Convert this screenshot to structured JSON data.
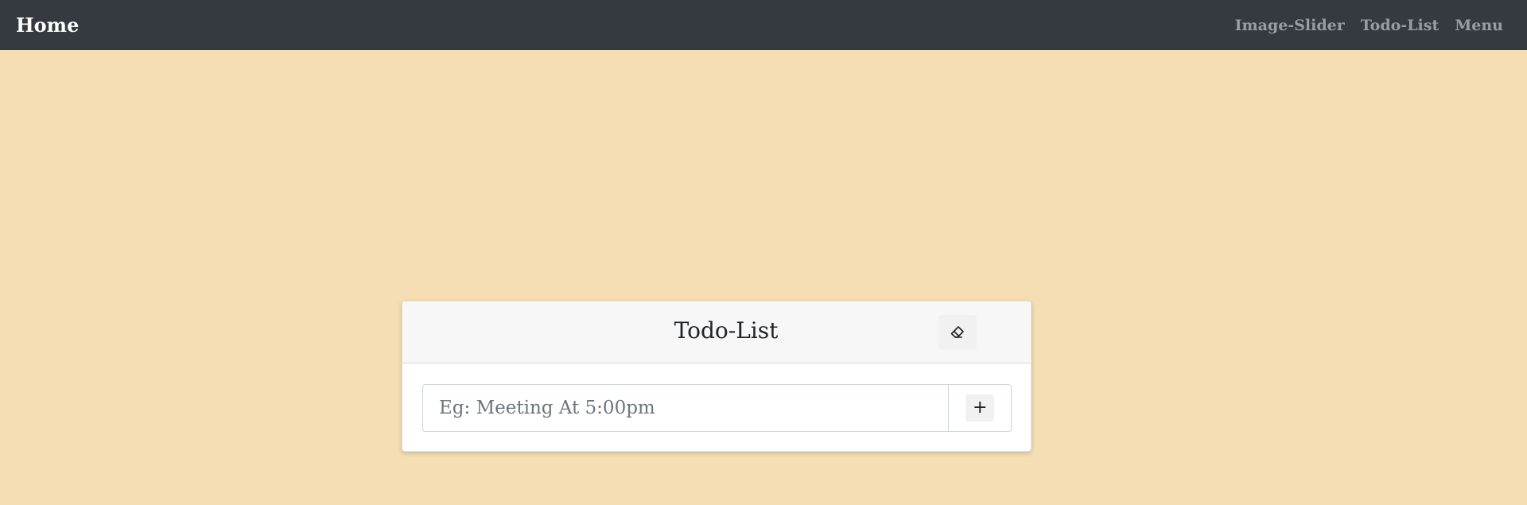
{
  "navbar": {
    "brand": "Home",
    "links": [
      {
        "label": "Image-Slider"
      },
      {
        "label": "Todo-List"
      },
      {
        "label": "Menu"
      }
    ]
  },
  "todo": {
    "title": "Todo-List",
    "clear_icon": "eraser-icon",
    "input_placeholder": "Eg: Meeting At 5:00pm",
    "input_value": "",
    "add_label": "+"
  },
  "colors": {
    "page_background": "#f5deb3",
    "navbar_background": "#343a40",
    "card_header_background": "#f7f7f7"
  }
}
